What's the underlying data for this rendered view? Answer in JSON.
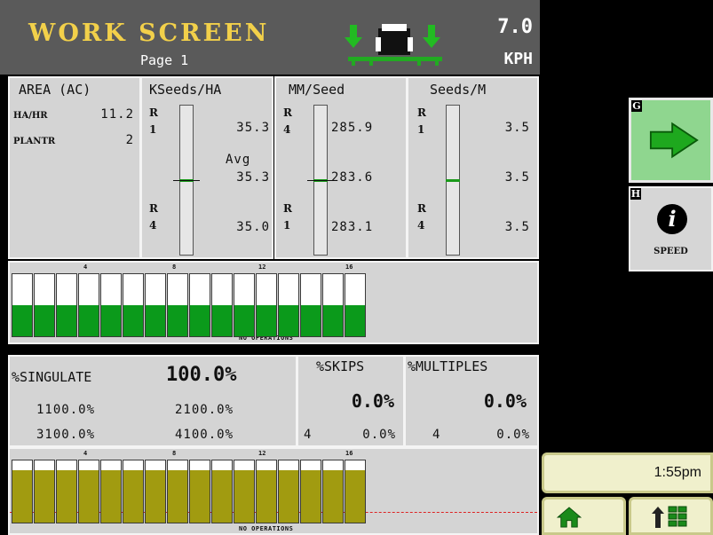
{
  "header": {
    "title": "WORK SCREEN",
    "page": "Page 1",
    "speed_value": "7.0",
    "speed_unit": "KPH",
    "icon": "tractor-planter-icon"
  },
  "area_panel": {
    "title": "AREA  (AC)",
    "rows": [
      {
        "label": "HA/HR",
        "value": "11.2"
      },
      {
        "label": "PLANTR",
        "value": "2"
      }
    ]
  },
  "gauges": [
    {
      "title": "KSeeds/HA",
      "top_row": "R\n1",
      "top_value": "35.3",
      "avg_label": "Avg",
      "avg_value": "35.3",
      "bottom_row": "R\n4",
      "bottom_value": "35.0",
      "level": 0.5
    },
    {
      "title": "MM/Seed",
      "top_row": "R\n4",
      "top_value": "285.9",
      "avg_value": "283.6",
      "bottom_row": "R\n1",
      "bottom_value": "283.1",
      "level": 0.5
    },
    {
      "title": "Seeds/M",
      "top_row": "R\n1",
      "top_value": "3.5",
      "avg_value": "3.5",
      "bottom_row": "R\n4",
      "bottom_value": "3.5",
      "level": 0.5
    }
  ],
  "row_chart_top": {
    "axis_labels": [
      "4",
      "8",
      "12",
      "16"
    ],
    "footer": "NO OPERATIONS",
    "fill_color": "#0b9a1b",
    "levels": [
      0.5,
      0.5,
      0.5,
      0.5,
      0.5,
      0.5,
      0.5,
      0.5,
      0.5,
      0.5,
      0.5,
      0.5,
      0.5,
      0.5,
      0.5,
      0.5
    ]
  },
  "singulation": {
    "label": "%SINGULATE",
    "value": "100.0%",
    "rows": [
      "1100.0%",
      "2100.0%",
      "3100.0%",
      "4100.0%"
    ]
  },
  "skips": {
    "label": "%SKIPS",
    "value": "0.0%",
    "row": "4",
    "row_value": "0.0%"
  },
  "multiples": {
    "label": "%MULTIPLES",
    "value": "0.0%",
    "row": "4",
    "row_value": "0.0%"
  },
  "row_chart_bottom": {
    "axis_labels": [
      "4",
      "8",
      "12",
      "16"
    ],
    "footer": "NO OPERATIONS",
    "fill_color": "#a19b10",
    "levels": [
      0.85,
      0.85,
      0.85,
      0.85,
      0.85,
      0.85,
      0.85,
      0.85,
      0.85,
      0.85,
      0.85,
      0.85,
      0.85,
      0.85,
      0.85,
      0.85
    ]
  },
  "softkeys": {
    "g_letter": "G",
    "g_icon": "arrow-right-icon",
    "h_letter": "H",
    "h_icon": "info-icon",
    "h_glyph": "i",
    "h_label": "SPEED"
  },
  "footer": {
    "time": "1:55pm",
    "home_icon": "home-icon",
    "menu_icon": "menu-up-icon"
  }
}
